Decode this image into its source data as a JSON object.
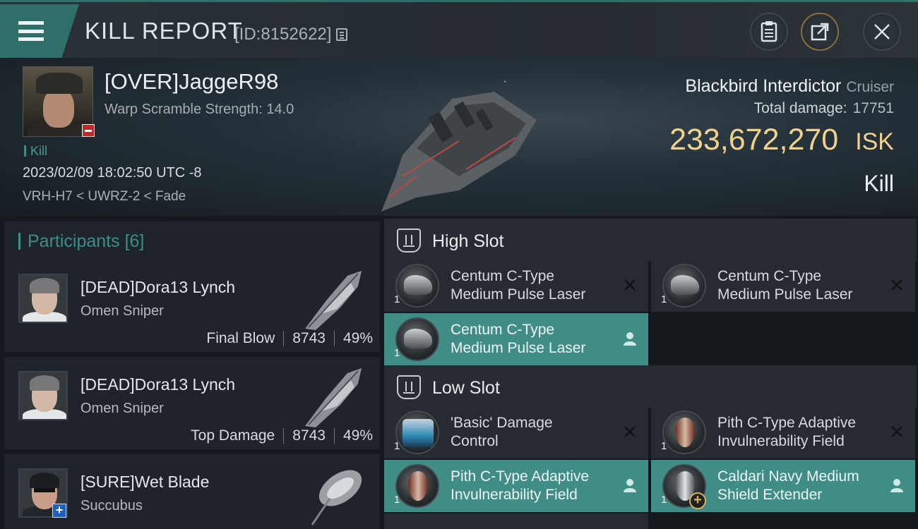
{
  "header": {
    "title": "KILL REPORT",
    "report_id": "[ID:8152622]"
  },
  "victim": {
    "name": "[OVER]JaggeR98",
    "warp_scramble": "Warp Scramble Strength: 14.0",
    "tag": "Kill",
    "datetime": "2023/02/09 18:02:50 UTC -8",
    "location": "VRH-H7 < UWRZ-2 < Fade",
    "ship_name": "Blackbird Interdictor",
    "ship_class": "Cruiser",
    "total_damage_label": "Total damage:",
    "total_damage": "17751",
    "isk_value": "233,672,270",
    "isk_unit": "ISK",
    "outcome": "Kill"
  },
  "participants": {
    "label": "Participants",
    "count": "[6]",
    "items": [
      {
        "name": "[DEAD]Dora13 Lynch",
        "ship": "Omen Sniper",
        "role": "Final Blow",
        "damage": "8743",
        "percent": "49%"
      },
      {
        "name": "[DEAD]Dora13 Lynch",
        "ship": "Omen Sniper",
        "role": "Top Damage",
        "damage": "8743",
        "percent": "49%"
      },
      {
        "name": "[SURE]Wet Blade",
        "ship": "Succubus",
        "role": "",
        "damage": "",
        "percent": ""
      }
    ]
  },
  "slots": {
    "high": {
      "label": "High Slot",
      "modules": [
        {
          "line1": "Centum C-Type",
          "line2": "Medium Pulse Laser",
          "qty": "1",
          "state": "destroyed"
        },
        {
          "line1": "Centum C-Type",
          "line2": "Medium Pulse Laser",
          "qty": "1",
          "state": "destroyed"
        },
        {
          "line1": "Centum C-Type",
          "line2": "Medium Pulse Laser",
          "qty": "1",
          "state": "dropped"
        }
      ]
    },
    "low": {
      "label": "Low Slot",
      "modules": [
        {
          "line1": "'Basic' Damage",
          "line2": "Control",
          "qty": "1",
          "state": "destroyed"
        },
        {
          "line1": "Pith C-Type Adaptive",
          "line2": "Invulnerability Field",
          "qty": "1",
          "state": "destroyed"
        },
        {
          "line1": "Pith C-Type Adaptive",
          "line2": "Invulnerability Field",
          "qty": "1",
          "state": "dropped"
        },
        {
          "line1": "Caldari Navy Medium",
          "line2": "Shield Extender",
          "qty": "1",
          "state": "dropped"
        }
      ]
    }
  },
  "colors": {
    "accent_teal": "#3f8d86",
    "isk_gold": "#f0d28f",
    "destroyed_badge": "#c0262a"
  },
  "icons": [
    "menu-icon",
    "copy-icon",
    "clipboard-icon",
    "share-icon",
    "close-icon",
    "high-slot-icon",
    "low-slot-icon",
    "destroyed-x-icon",
    "dropped-person-icon"
  ]
}
